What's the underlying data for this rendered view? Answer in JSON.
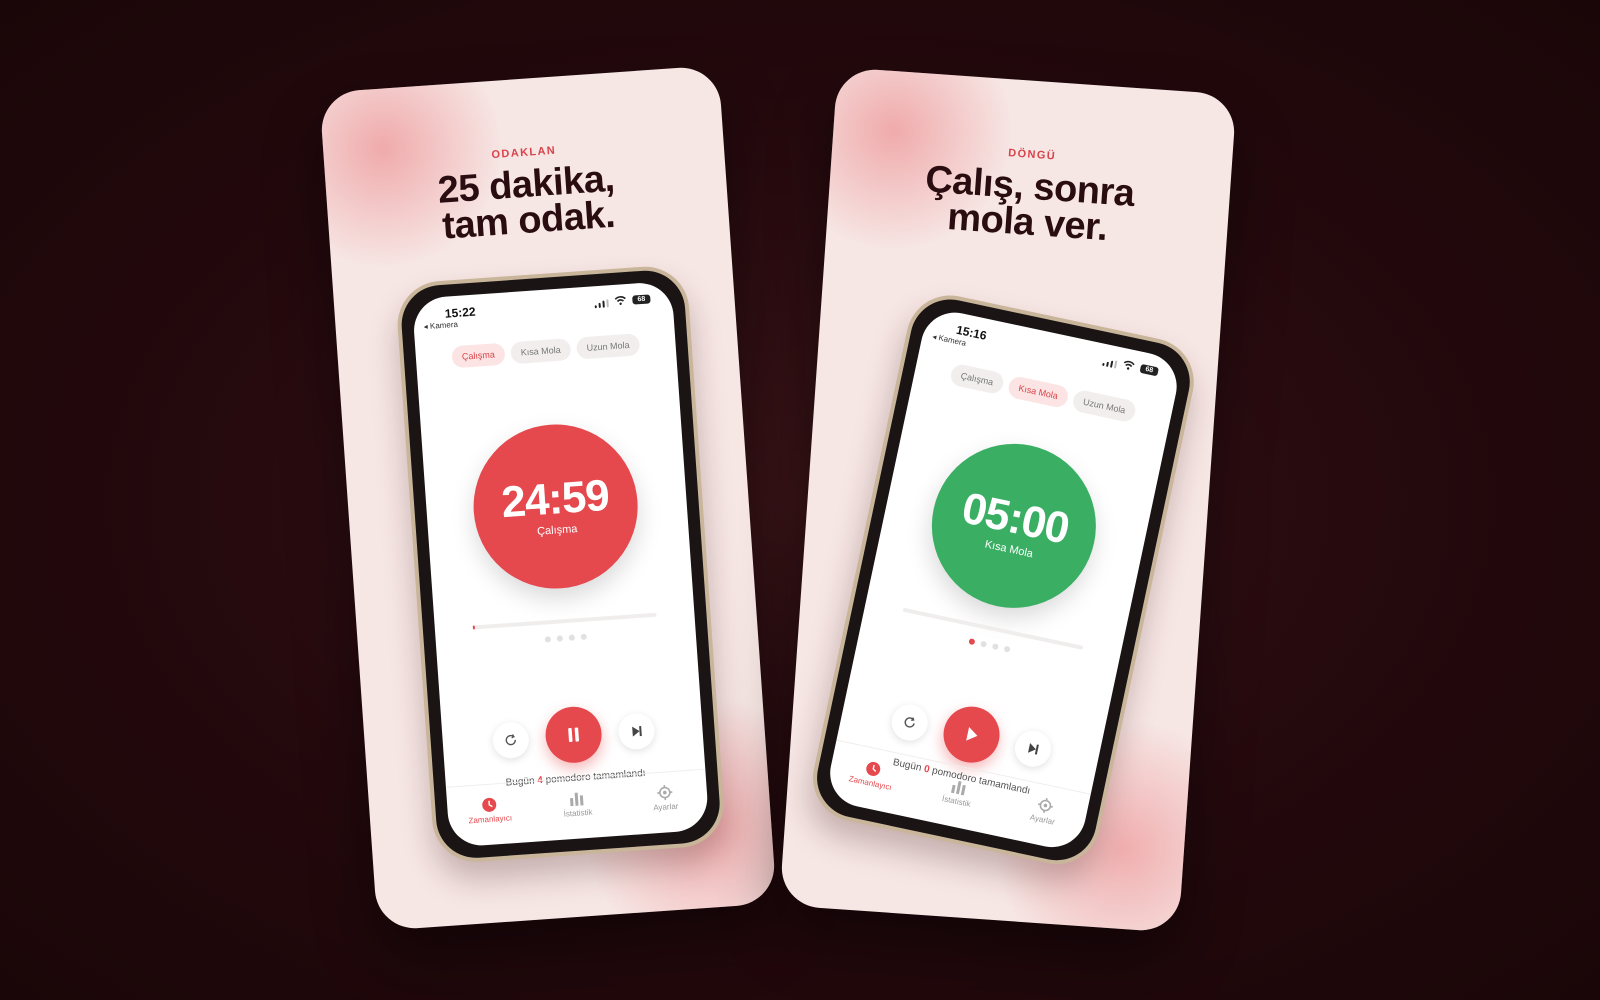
{
  "colors": {
    "background": "#24090d",
    "card": "#f6e6e4",
    "accent_red": "#e5484d",
    "accent_green": "#3aaf64",
    "eyebrow": "#d9434b",
    "headline": "#2a0d10"
  },
  "cards": [
    {
      "eyebrow": "ODAKLAN",
      "headline_line1": "25 dakika,",
      "headline_line2": "tam odak.",
      "phone": {
        "time": "15:22",
        "back_label": "◂ Kamera",
        "battery": "68",
        "tabs": [
          "Çalışma",
          "Kısa Mola",
          "Uzun Mola"
        ],
        "active_tab": 0,
        "timer": "24:59",
        "timer_label": "Çalışma",
        "timer_color": "#e5484d",
        "progress_fraction": 0.01,
        "session_dots": 4,
        "active_dot": -1,
        "main_control": "pause",
        "today_prefix": "Bugün",
        "today_count": "4",
        "today_suffix": "pomodoro tamamlandı",
        "tabbar": [
          "Zamanlayıcı",
          "İstatistik",
          "Ayarlar"
        ],
        "tabbar_icons": [
          "timer-icon",
          "bar-chart-icon",
          "gear-icon"
        ]
      }
    },
    {
      "eyebrow": "DÖNGÜ",
      "headline_line1": "Çalış, sonra",
      "headline_line2": "mola ver.",
      "phone": {
        "time": "15:16",
        "back_label": "◂ Kamera",
        "battery": "68",
        "tabs": [
          "Çalışma",
          "Kısa Mola",
          "Uzun Mola"
        ],
        "active_tab": 1,
        "timer": "05:00",
        "timer_label": "Kısa Mola",
        "timer_color": "#3aaf64",
        "progress_fraction": 0,
        "session_dots": 4,
        "active_dot": 0,
        "main_control": "play",
        "today_prefix": "Bugün",
        "today_count": "0",
        "today_suffix": "pomodoro tamamlandı",
        "tabbar": [
          "Zamanlayıcı",
          "İstatistik",
          "Ayarlar"
        ],
        "tabbar_icons": [
          "timer-icon",
          "bar-chart-icon",
          "gear-icon"
        ]
      }
    }
  ]
}
